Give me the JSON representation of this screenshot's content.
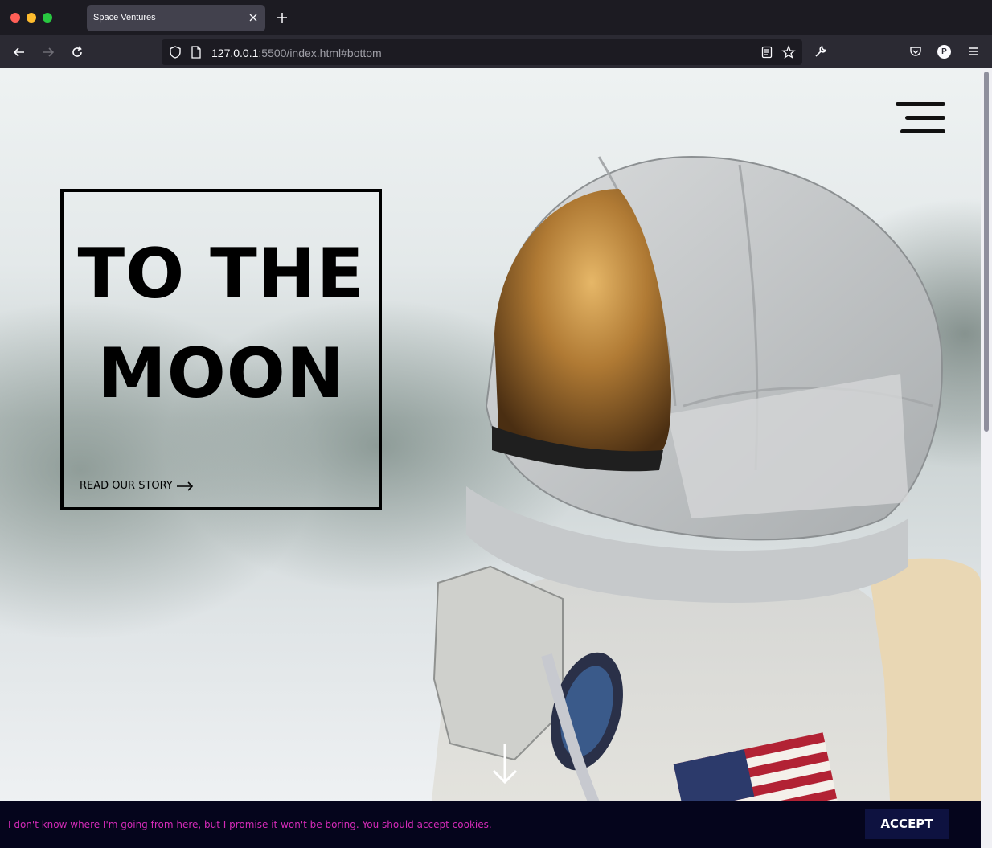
{
  "browser": {
    "tab_title": "Space Ventures",
    "url_host": "127.0.0.1",
    "url_rest": ":5500/index.html#bottom",
    "icons": {
      "back": "arrow-left-icon",
      "forward": "arrow-right-icon",
      "reload": "reload-icon",
      "shield": "shield-icon",
      "page": "page-icon",
      "reader": "reader-view-icon",
      "bookmark": "star-icon",
      "tools": "wrench-icon",
      "pocket": "pocket-icon",
      "profile": "profile-icon",
      "menu": "menu-icon"
    },
    "profile_initial": "P"
  },
  "page": {
    "hero": {
      "title_line1": "TO THE",
      "title_line2": "MOON",
      "link_label": "READ OUR STORY"
    },
    "cookie_banner": {
      "text": "I don't know where I'm going from here, but I promise it won't be boring. You should accept cookies.",
      "accept_label": "ACCEPT",
      "text_color": "#d42bb8",
      "background": "#05051c"
    }
  }
}
